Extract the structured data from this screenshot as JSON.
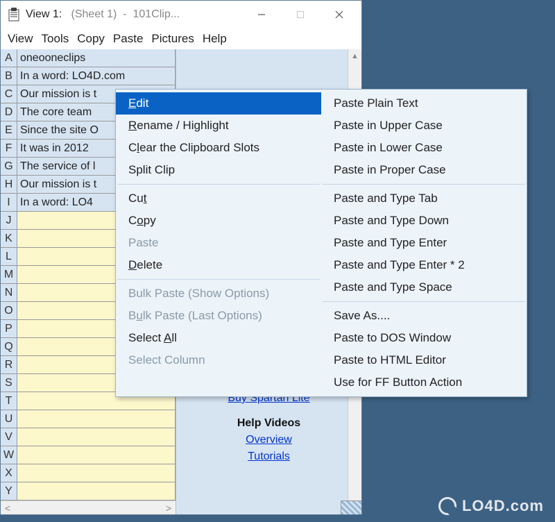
{
  "window": {
    "title_prefix": "View 1:",
    "title_sheet": "(Sheet 1)",
    "title_app": "101Clip..."
  },
  "menubar": [
    "View",
    "Tools",
    "Copy",
    "Paste",
    "Pictures",
    "Help"
  ],
  "rows": [
    {
      "h": "A",
      "t": "oneooneclips",
      "f": true
    },
    {
      "h": "B",
      "t": "In a word: LO4D.com",
      "f": true
    },
    {
      "h": "C",
      "t": "Our mission is t",
      "f": true
    },
    {
      "h": "D",
      "t": "The core team",
      "f": true
    },
    {
      "h": "E",
      "t": "Since the site O",
      "f": true
    },
    {
      "h": "F",
      "t": "It was in 2012",
      "f": true
    },
    {
      "h": "G",
      "t": "The service of l",
      "f": true
    },
    {
      "h": "H",
      "t": "Our mission is t",
      "f": true
    },
    {
      "h": "I",
      "t": "In a word: LO4",
      "f": true
    },
    {
      "h": "J",
      "t": "",
      "f": false
    },
    {
      "h": "K",
      "t": "",
      "f": false
    },
    {
      "h": "L",
      "t": "",
      "f": false
    },
    {
      "h": "M",
      "t": "",
      "f": false
    },
    {
      "h": "N",
      "t": "",
      "f": false
    },
    {
      "h": "O",
      "t": "",
      "f": false
    },
    {
      "h": "P",
      "t": "",
      "f": false
    },
    {
      "h": "Q",
      "t": "",
      "f": false
    },
    {
      "h": "R",
      "t": "",
      "f": false
    },
    {
      "h": "S",
      "t": "",
      "f": false
    },
    {
      "h": "T",
      "t": "",
      "f": false
    },
    {
      "h": "U",
      "t": "",
      "f": false
    },
    {
      "h": "V",
      "t": "",
      "f": false
    },
    {
      "h": "W",
      "t": "",
      "f": false
    },
    {
      "h": "X",
      "t": "",
      "f": false
    },
    {
      "h": "Y",
      "t": "",
      "f": false
    }
  ],
  "right_pane": {
    "buy_link": "Buy Spartan Lite",
    "help_heading": "Help Videos",
    "overview": "Overview",
    "tutorials": "Tutorials"
  },
  "context_menu": {
    "left": [
      {
        "label": "Edit",
        "hl": true,
        "u": [
          0
        ]
      },
      {
        "label": "Rename / Highlight",
        "u": [
          0
        ]
      },
      {
        "label": "Clear the Clipboard Slots",
        "u": [
          1
        ]
      },
      {
        "label": "Split Clip"
      },
      {
        "sep": true
      },
      {
        "label": "Cut",
        "u": [
          2
        ]
      },
      {
        "label": "Copy",
        "u": [
          1
        ]
      },
      {
        "label": "Paste",
        "disabled": true
      },
      {
        "label": "Delete",
        "u": [
          0
        ]
      },
      {
        "sep": true
      },
      {
        "label": "Bulk Paste (Show Options)",
        "disabled": true
      },
      {
        "label": "Bulk Paste (Last Options)",
        "disabled": true,
        "u": [
          1
        ]
      },
      {
        "label": "Select All",
        "u": [
          7
        ]
      },
      {
        "label": "Select Column",
        "disabled": true
      }
    ],
    "right": [
      {
        "label": "Paste Plain Text"
      },
      {
        "label": "Paste in Upper Case"
      },
      {
        "label": "Paste in Lower Case"
      },
      {
        "label": "Paste in Proper Case"
      },
      {
        "sep": true
      },
      {
        "label": "Paste and Type Tab"
      },
      {
        "label": "Paste and Type Down"
      },
      {
        "label": "Paste and Type Enter"
      },
      {
        "label": "Paste and Type Enter * 2"
      },
      {
        "label": "Paste and Type Space"
      },
      {
        "sep": true
      },
      {
        "label": "Save As...."
      },
      {
        "label": "Paste to DOS Window"
      },
      {
        "label": "Paste to HTML Editor"
      },
      {
        "label": "Use for FF Button Action"
      }
    ]
  },
  "watermark": "LO4D.com"
}
